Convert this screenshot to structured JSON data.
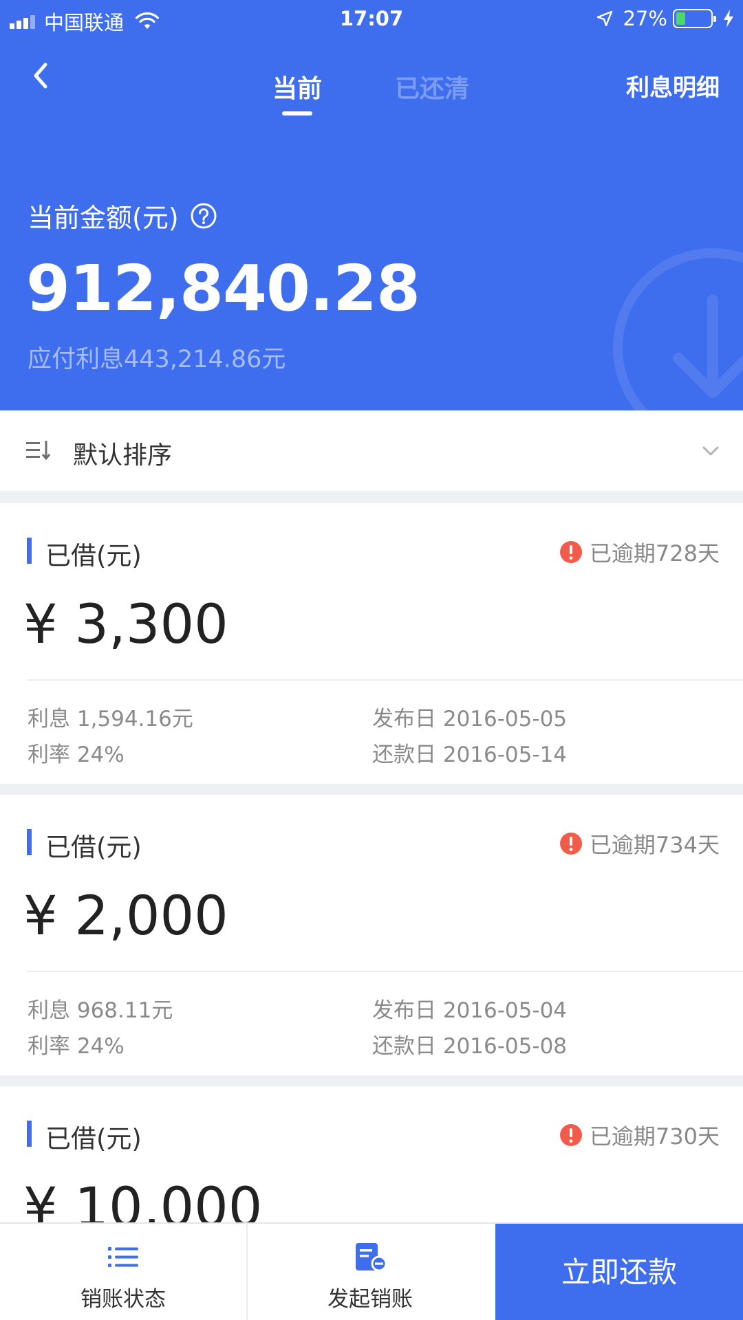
{
  "status_bar": {
    "carrier": "中国联通",
    "time": "17:07",
    "battery": "27%",
    "battery_level": 0.27
  },
  "nav": {
    "back_icon": "chevron-left-icon",
    "tabs": [
      {
        "label": "当前",
        "active": true
      },
      {
        "label": "已还清",
        "active": false
      }
    ],
    "right_link": "利息明细"
  },
  "summary": {
    "label": "当前金额(元)",
    "help_icon": "question-circle-icon",
    "amount": "912,840.28",
    "interest_due": "应付利息443,214.86元"
  },
  "sort": {
    "icon": "sort-icon",
    "label": "默认排序",
    "dropdown_icon": "chevron-down-icon"
  },
  "loans": [
    {
      "label": "已借(元)",
      "overdue": "已逾期728天",
      "amount": "¥ 3,300",
      "interest": "利息 1,594.16元",
      "rate": "利率 24%",
      "issue_date": "发布日 2016-05-05",
      "due_date": "还款日 2016-05-14"
    },
    {
      "label": "已借(元)",
      "overdue": "已逾期734天",
      "amount": "¥ 2,000",
      "interest": "利息 968.11元",
      "rate": "利率 24%",
      "issue_date": "发布日 2016-05-04",
      "due_date": "还款日 2016-05-08"
    },
    {
      "label": "已借(元)",
      "overdue": "已逾期730天",
      "amount": "¥ 10,000"
    }
  ],
  "bottom_bar": {
    "status_label": "销账状态",
    "status_icon": "list-icon",
    "initiate_label": "发起销账",
    "initiate_icon": "document-minus-icon",
    "repay_label": "立即还款"
  },
  "colors": {
    "primary": "#3e6ded",
    "alert": "#f25a4a",
    "battery": "#4cd964"
  }
}
